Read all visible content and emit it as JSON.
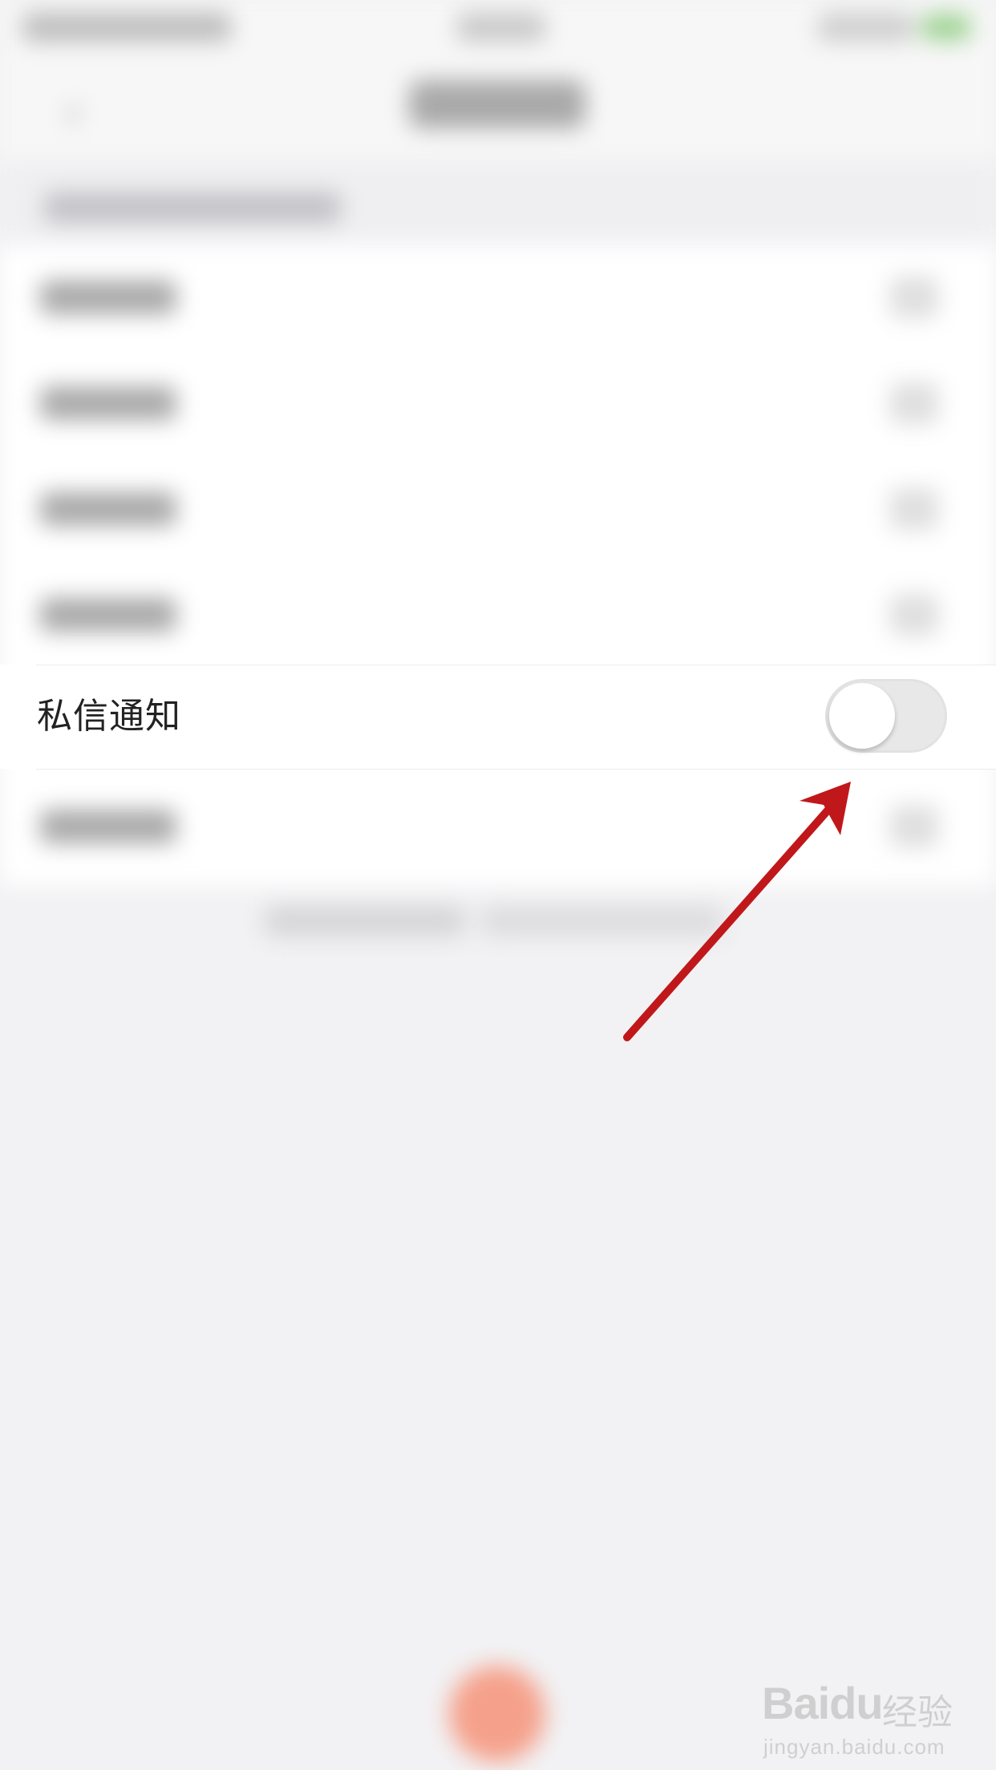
{
  "settings": {
    "focused_item": {
      "label": "私信通知",
      "toggle": {
        "state": "off"
      }
    }
  },
  "colors": {
    "annotation_arrow": "#c0181a",
    "background": "#f2f2f4",
    "row_background": "#ffffff",
    "toggle_track_off": "#e8e8e8",
    "bottom_button": "#f5a08a"
  },
  "watermark": {
    "logo": "Baidu",
    "name": "经验",
    "url": "jingyan.baidu.com"
  }
}
